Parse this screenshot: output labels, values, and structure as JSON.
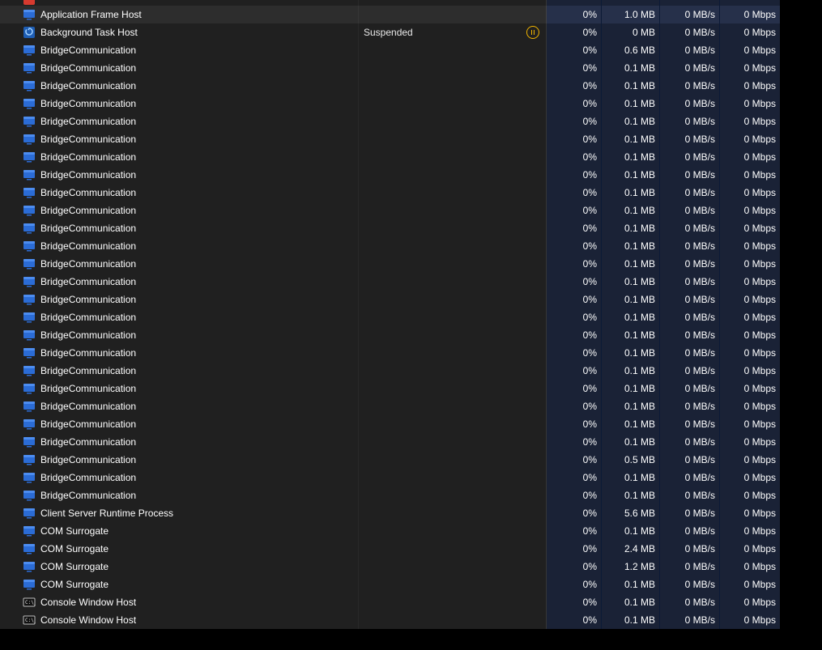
{
  "processes": [
    {
      "icon": "red",
      "name": "",
      "status": "",
      "cpu": "",
      "mem": "",
      "disk": "",
      "net": "",
      "sliver": true
    },
    {
      "icon": "app",
      "name": "Application Frame Host",
      "status": "",
      "cpu": "0%",
      "mem": "1.0 MB",
      "disk": "0 MB/s",
      "net": "0 Mbps",
      "selected": true
    },
    {
      "icon": "bgtask",
      "name": "Background Task Host",
      "status": "Suspended",
      "showPause": true,
      "cpu": "0%",
      "mem": "0 MB",
      "disk": "0 MB/s",
      "net": "0 Mbps"
    },
    {
      "icon": "app",
      "name": "BridgeCommunication",
      "status": "",
      "cpu": "0%",
      "mem": "0.6 MB",
      "disk": "0 MB/s",
      "net": "0 Mbps"
    },
    {
      "icon": "app",
      "name": "BridgeCommunication",
      "status": "",
      "cpu": "0%",
      "mem": "0.1 MB",
      "disk": "0 MB/s",
      "net": "0 Mbps"
    },
    {
      "icon": "app",
      "name": "BridgeCommunication",
      "status": "",
      "cpu": "0%",
      "mem": "0.1 MB",
      "disk": "0 MB/s",
      "net": "0 Mbps"
    },
    {
      "icon": "app",
      "name": "BridgeCommunication",
      "status": "",
      "cpu": "0%",
      "mem": "0.1 MB",
      "disk": "0 MB/s",
      "net": "0 Mbps"
    },
    {
      "icon": "app",
      "name": "BridgeCommunication",
      "status": "",
      "cpu": "0%",
      "mem": "0.1 MB",
      "disk": "0 MB/s",
      "net": "0 Mbps"
    },
    {
      "icon": "app",
      "name": "BridgeCommunication",
      "status": "",
      "cpu": "0%",
      "mem": "0.1 MB",
      "disk": "0 MB/s",
      "net": "0 Mbps"
    },
    {
      "icon": "app",
      "name": "BridgeCommunication",
      "status": "",
      "cpu": "0%",
      "mem": "0.1 MB",
      "disk": "0 MB/s",
      "net": "0 Mbps"
    },
    {
      "icon": "app",
      "name": "BridgeCommunication",
      "status": "",
      "cpu": "0%",
      "mem": "0.1 MB",
      "disk": "0 MB/s",
      "net": "0 Mbps"
    },
    {
      "icon": "app",
      "name": "BridgeCommunication",
      "status": "",
      "cpu": "0%",
      "mem": "0.1 MB",
      "disk": "0 MB/s",
      "net": "0 Mbps"
    },
    {
      "icon": "app",
      "name": "BridgeCommunication",
      "status": "",
      "cpu": "0%",
      "mem": "0.1 MB",
      "disk": "0 MB/s",
      "net": "0 Mbps"
    },
    {
      "icon": "app",
      "name": "BridgeCommunication",
      "status": "",
      "cpu": "0%",
      "mem": "0.1 MB",
      "disk": "0 MB/s",
      "net": "0 Mbps"
    },
    {
      "icon": "app",
      "name": "BridgeCommunication",
      "status": "",
      "cpu": "0%",
      "mem": "0.1 MB",
      "disk": "0 MB/s",
      "net": "0 Mbps"
    },
    {
      "icon": "app",
      "name": "BridgeCommunication",
      "status": "",
      "cpu": "0%",
      "mem": "0.1 MB",
      "disk": "0 MB/s",
      "net": "0 Mbps"
    },
    {
      "icon": "app",
      "name": "BridgeCommunication",
      "status": "",
      "cpu": "0%",
      "mem": "0.1 MB",
      "disk": "0 MB/s",
      "net": "0 Mbps"
    },
    {
      "icon": "app",
      "name": "BridgeCommunication",
      "status": "",
      "cpu": "0%",
      "mem": "0.1 MB",
      "disk": "0 MB/s",
      "net": "0 Mbps"
    },
    {
      "icon": "app",
      "name": "BridgeCommunication",
      "status": "",
      "cpu": "0%",
      "mem": "0.1 MB",
      "disk": "0 MB/s",
      "net": "0 Mbps"
    },
    {
      "icon": "app",
      "name": "BridgeCommunication",
      "status": "",
      "cpu": "0%",
      "mem": "0.1 MB",
      "disk": "0 MB/s",
      "net": "0 Mbps"
    },
    {
      "icon": "app",
      "name": "BridgeCommunication",
      "status": "",
      "cpu": "0%",
      "mem": "0.1 MB",
      "disk": "0 MB/s",
      "net": "0 Mbps"
    },
    {
      "icon": "app",
      "name": "BridgeCommunication",
      "status": "",
      "cpu": "0%",
      "mem": "0.1 MB",
      "disk": "0 MB/s",
      "net": "0 Mbps"
    },
    {
      "icon": "app",
      "name": "BridgeCommunication",
      "status": "",
      "cpu": "0%",
      "mem": "0.1 MB",
      "disk": "0 MB/s",
      "net": "0 Mbps"
    },
    {
      "icon": "app",
      "name": "BridgeCommunication",
      "status": "",
      "cpu": "0%",
      "mem": "0.1 MB",
      "disk": "0 MB/s",
      "net": "0 Mbps"
    },
    {
      "icon": "app",
      "name": "BridgeCommunication",
      "status": "",
      "cpu": "0%",
      "mem": "0.1 MB",
      "disk": "0 MB/s",
      "net": "0 Mbps"
    },
    {
      "icon": "app",
      "name": "BridgeCommunication",
      "status": "",
      "cpu": "0%",
      "mem": "0.1 MB",
      "disk": "0 MB/s",
      "net": "0 Mbps"
    },
    {
      "icon": "app",
      "name": "BridgeCommunication",
      "status": "",
      "cpu": "0%",
      "mem": "0.5 MB",
      "disk": "0 MB/s",
      "net": "0 Mbps"
    },
    {
      "icon": "app",
      "name": "BridgeCommunication",
      "status": "",
      "cpu": "0%",
      "mem": "0.1 MB",
      "disk": "0 MB/s",
      "net": "0 Mbps"
    },
    {
      "icon": "app",
      "name": "BridgeCommunication",
      "status": "",
      "cpu": "0%",
      "mem": "0.1 MB",
      "disk": "0 MB/s",
      "net": "0 Mbps"
    },
    {
      "icon": "app",
      "name": "Client Server Runtime Process",
      "status": "",
      "cpu": "0%",
      "mem": "5.6 MB",
      "disk": "0 MB/s",
      "net": "0 Mbps"
    },
    {
      "icon": "app",
      "name": "COM Surrogate",
      "status": "",
      "cpu": "0%",
      "mem": "0.1 MB",
      "disk": "0 MB/s",
      "net": "0 Mbps"
    },
    {
      "icon": "app",
      "name": "COM Surrogate",
      "status": "",
      "cpu": "0%",
      "mem": "2.4 MB",
      "disk": "0 MB/s",
      "net": "0 Mbps"
    },
    {
      "icon": "app",
      "name": "COM Surrogate",
      "status": "",
      "cpu": "0%",
      "mem": "1.2 MB",
      "disk": "0 MB/s",
      "net": "0 Mbps"
    },
    {
      "icon": "app",
      "name": "COM Surrogate",
      "status": "",
      "cpu": "0%",
      "mem": "0.1 MB",
      "disk": "0 MB/s",
      "net": "0 Mbps"
    },
    {
      "icon": "console",
      "name": "Console Window Host",
      "status": "",
      "cpu": "0%",
      "mem": "0.1 MB",
      "disk": "0 MB/s",
      "net": "0 Mbps"
    },
    {
      "icon": "console",
      "name": "Console Window Host",
      "status": "",
      "cpu": "0%",
      "mem": "0.1 MB",
      "disk": "0 MB/s",
      "net": "0 Mbps"
    }
  ]
}
